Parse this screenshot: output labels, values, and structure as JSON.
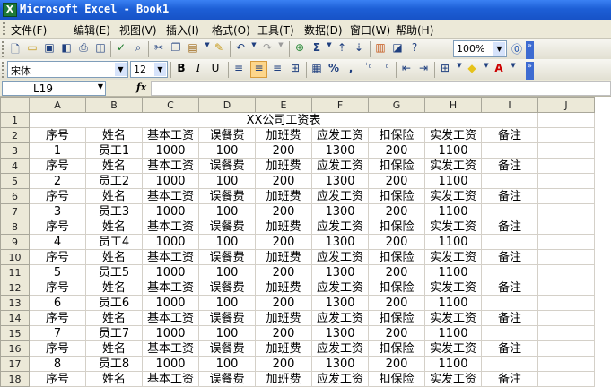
{
  "window": {
    "title": "Microsoft Excel - Book1",
    "app_icon": "excel-icon"
  },
  "menu": [
    "文件(F)",
    "编辑(E)",
    "视图(V)",
    "插入(I)",
    "格式(O)",
    "工具(T)",
    "数据(D)",
    "窗口(W)",
    "帮助(H)"
  ],
  "toolbar_standard": {
    "zoom": "100%"
  },
  "toolbar_format": {
    "font": "宋体",
    "font_size": "12",
    "bold": "B",
    "italic": "I",
    "underline": "U",
    "percent": "%"
  },
  "formula_bar": {
    "cell_ref": "L19",
    "fx": "fx",
    "formula": ""
  },
  "sheet": {
    "columns": [
      "A",
      "B",
      "C",
      "D",
      "E",
      "F",
      "G",
      "H",
      "I",
      "J"
    ],
    "row_numbers": [
      "1",
      "2",
      "3",
      "4",
      "5",
      "6",
      "7",
      "8",
      "9",
      "10",
      "11",
      "12",
      "13",
      "14",
      "15",
      "16",
      "17",
      "18"
    ],
    "title": "XX公司工资表",
    "header_row": [
      "序号",
      "姓名",
      "基本工资",
      "误餐费",
      "加班费",
      "应发工资",
      "扣保险",
      "实发工资",
      "备注"
    ],
    "records": [
      [
        "1",
        "员工1",
        "1000",
        "100",
        "200",
        "1300",
        "200",
        "1100"
      ],
      [
        "2",
        "员工2",
        "1000",
        "100",
        "200",
        "1300",
        "200",
        "1100"
      ],
      [
        "3",
        "员工3",
        "1000",
        "100",
        "200",
        "1300",
        "200",
        "1100"
      ],
      [
        "4",
        "员工4",
        "1000",
        "100",
        "200",
        "1300",
        "200",
        "1100"
      ],
      [
        "5",
        "员工5",
        "1000",
        "100",
        "200",
        "1300",
        "200",
        "1100"
      ],
      [
        "6",
        "员工6",
        "1000",
        "100",
        "200",
        "1300",
        "200",
        "1100"
      ],
      [
        "7",
        "员工7",
        "1000",
        "100",
        "200",
        "1300",
        "200",
        "1100"
      ],
      [
        "8",
        "员工8",
        "1000",
        "100",
        "200",
        "1300",
        "200",
        "1100"
      ]
    ]
  }
}
